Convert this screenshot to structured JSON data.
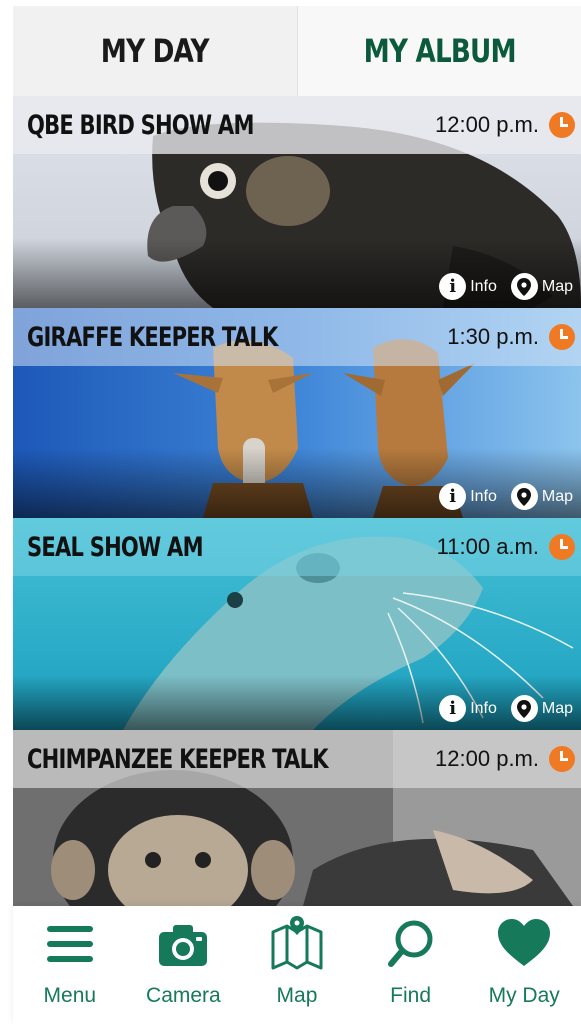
{
  "tabs": {
    "my_day": "MY DAY",
    "my_album": "MY ALBUM"
  },
  "events": [
    {
      "title": "QBE BIRD SHOW AM",
      "time": "12:00 p.m.",
      "info_label": "Info",
      "map_label": "Map"
    },
    {
      "title": "GIRAFFE KEEPER TALK",
      "time": "1:30 p.m.",
      "info_label": "Info",
      "map_label": "Map"
    },
    {
      "title": "SEAL SHOW AM",
      "time": "11:00 a.m.",
      "info_label": "Info",
      "map_label": "Map"
    },
    {
      "title": "CHIMPANZEE KEEPER TALK",
      "time": "12:00 p.m."
    }
  ],
  "bottom_nav": [
    {
      "label": "Menu",
      "icon": "menu-icon"
    },
    {
      "label": "Camera",
      "icon": "camera-icon"
    },
    {
      "label": "Map",
      "icon": "map-icon"
    },
    {
      "label": "Find",
      "icon": "search-icon"
    },
    {
      "label": "My Day",
      "icon": "heart-icon"
    }
  ],
  "colors": {
    "brand_green": "#0c5a3c",
    "accent_orange": "#f07a24",
    "nav_green": "#167a5a"
  }
}
